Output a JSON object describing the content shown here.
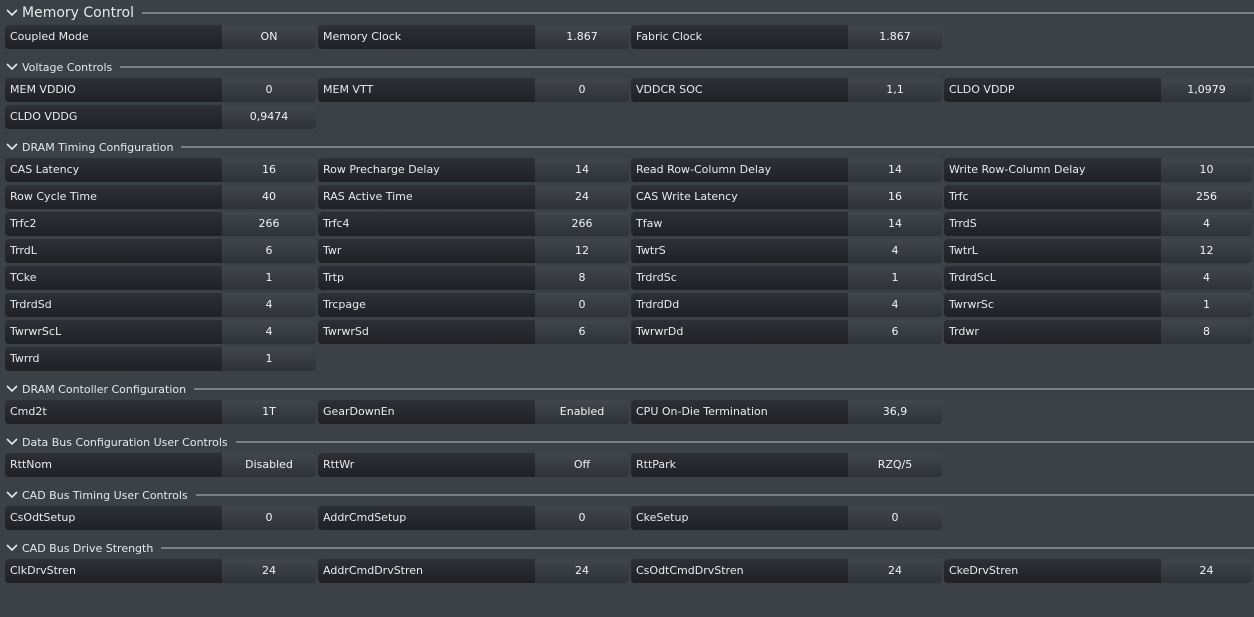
{
  "sections": [
    {
      "title": "Memory Control",
      "big": true,
      "rows": [
        [
          {
            "label": "Coupled Mode",
            "value": "ON"
          },
          {
            "label": "Memory Clock",
            "value": "1.867"
          },
          {
            "label": "Fabric Clock",
            "value": "1.867"
          }
        ]
      ]
    },
    {
      "title": "Voltage Controls",
      "rows": [
        [
          {
            "label": "MEM VDDIO",
            "value": "0"
          },
          {
            "label": "MEM VTT",
            "value": "0"
          },
          {
            "label": "VDDCR SOC",
            "value": "1,1"
          },
          {
            "label": "CLDO VDDP",
            "value": "1,0979"
          }
        ],
        [
          {
            "label": "CLDO VDDG",
            "value": "0,9474"
          }
        ]
      ]
    },
    {
      "title": "DRAM Timing Configuration",
      "rows": [
        [
          {
            "label": "CAS Latency",
            "value": "16"
          },
          {
            "label": "Row Precharge Delay",
            "value": "14"
          },
          {
            "label": "Read Row-Column Delay",
            "value": "14"
          },
          {
            "label": "Write Row-Column Delay",
            "value": "10"
          }
        ],
        [
          {
            "label": "Row Cycle Time",
            "value": "40"
          },
          {
            "label": "RAS Active Time",
            "value": "24"
          },
          {
            "label": "CAS Write Latency",
            "value": "16"
          },
          {
            "label": "Trfc",
            "value": "256"
          }
        ],
        [
          {
            "label": "Trfc2",
            "value": "266"
          },
          {
            "label": "Trfc4",
            "value": "266"
          },
          {
            "label": "Tfaw",
            "value": "14"
          },
          {
            "label": "TrrdS",
            "value": "4"
          }
        ],
        [
          {
            "label": "TrrdL",
            "value": "6"
          },
          {
            "label": "Twr",
            "value": "12"
          },
          {
            "label": "TwtrS",
            "value": "4"
          },
          {
            "label": "TwtrL",
            "value": "12"
          }
        ],
        [
          {
            "label": "TCke",
            "value": "1"
          },
          {
            "label": "Trtp",
            "value": "8"
          },
          {
            "label": "TrdrdSc",
            "value": "1"
          },
          {
            "label": "TrdrdScL",
            "value": "4"
          }
        ],
        [
          {
            "label": "TrdrdSd",
            "value": "4"
          },
          {
            "label": "Trcpage",
            "value": "0"
          },
          {
            "label": "TrdrdDd",
            "value": "4"
          },
          {
            "label": "TwrwrSc",
            "value": "1"
          }
        ],
        [
          {
            "label": "TwrwrScL",
            "value": "4"
          },
          {
            "label": "TwrwrSd",
            "value": "6"
          },
          {
            "label": "TwrwrDd",
            "value": "6"
          },
          {
            "label": "Trdwr",
            "value": "8"
          }
        ],
        [
          {
            "label": "Twrrd",
            "value": "1"
          }
        ]
      ]
    },
    {
      "title": "DRAM Contoller Configuration",
      "rows": [
        [
          {
            "label": "Cmd2t",
            "value": "1T"
          },
          {
            "label": "GearDownEn",
            "value": "Enabled"
          },
          {
            "label": "CPU On-Die Termination",
            "value": "36,9"
          }
        ]
      ]
    },
    {
      "title": "Data Bus Configuration User Controls",
      "rows": [
        [
          {
            "label": "RttNom",
            "value": "Disabled"
          },
          {
            "label": "RttWr",
            "value": "Off"
          },
          {
            "label": "RttPark",
            "value": "RZQ/5"
          }
        ]
      ]
    },
    {
      "title": "CAD Bus Timing User Controls",
      "rows": [
        [
          {
            "label": "CsOdtSetup",
            "value": "0"
          },
          {
            "label": "AddrCmdSetup",
            "value": "0"
          },
          {
            "label": "CkeSetup",
            "value": "0"
          }
        ]
      ]
    },
    {
      "title": "CAD Bus Drive Strength",
      "rows": [
        [
          {
            "label": "ClkDrvStren",
            "value": "24"
          },
          {
            "label": "AddrCmdDrvStren",
            "value": "24"
          },
          {
            "label": "CsOdtCmdDrvStren",
            "value": "24"
          },
          {
            "label": "CkeDrvStren",
            "value": "24"
          }
        ]
      ]
    }
  ]
}
